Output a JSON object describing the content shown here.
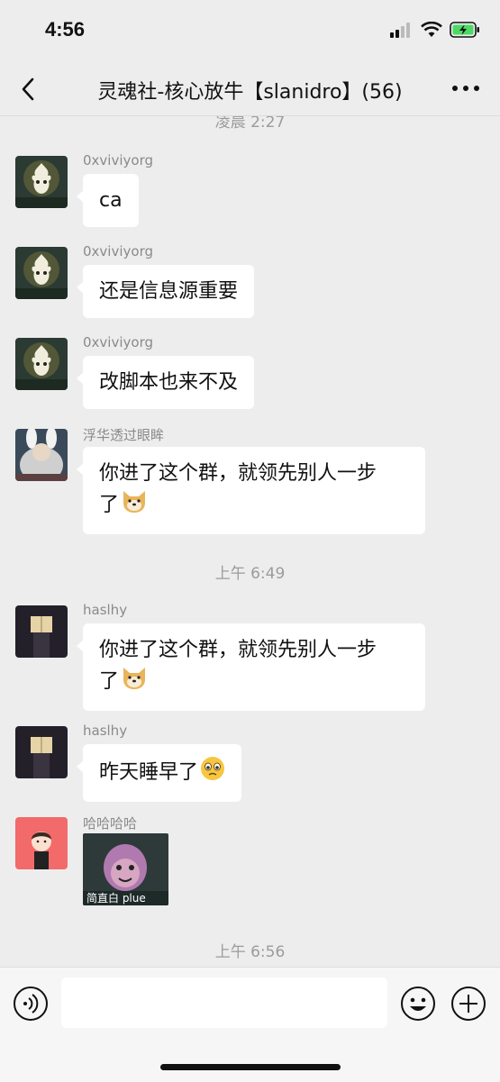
{
  "status_bar": {
    "time": "4:56"
  },
  "nav": {
    "title": "灵魂社-核心放牛【slanidro】(56)"
  },
  "chat": {
    "timestamps": [
      "凌晨 2:27",
      "上午 6:49",
      "上午 6:56"
    ],
    "messages": [
      {
        "sender": "0xviviyorg",
        "text": "ca"
      },
      {
        "sender": "0xviviyorg",
        "text": "还是信息源重要"
      },
      {
        "sender": "0xviviyorg",
        "text": "改脚本也来不及"
      },
      {
        "sender": "浮华透过眼眸",
        "line1": "你进了这个群，就领先别人一步",
        "line2": "了"
      },
      {
        "sender": "haslhy",
        "line1": "你进了这个群，就领先别人一步",
        "line2": "了"
      },
      {
        "sender": "haslhy",
        "text": "昨天睡早了"
      },
      {
        "sender": "哈哈哈哈",
        "sticker_caption": "简直白 plue"
      }
    ]
  },
  "colors": {
    "background": "#ededed",
    "bubble": "#ffffff",
    "battery": "#4cd964"
  },
  "icons": [
    "back-arrow-icon",
    "more-icon",
    "voice-icon",
    "emoji-icon",
    "plus-icon"
  ]
}
